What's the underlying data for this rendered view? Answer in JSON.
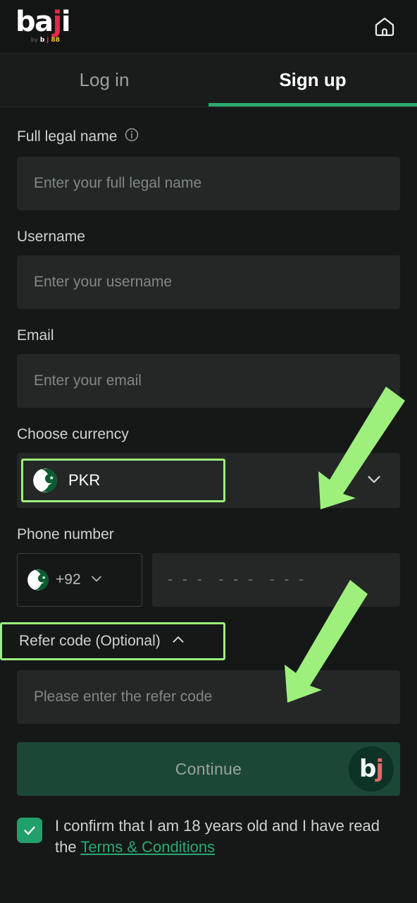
{
  "brand": {
    "logo_main_1": "ba",
    "logo_main_j": "j",
    "logo_main_2": "i",
    "logo_sub_by": "by",
    "logo_sub_b": "b",
    "logo_sub_j": "j",
    "logo_sub_88": "88",
    "badge_b": "b",
    "badge_j": "j",
    "accent_green": "#2aa971",
    "accent_red": "#e8254a",
    "accent_yellow": "#f5c518",
    "highlight_green": "#9ef07c",
    "button_green": "#1c4736",
    "checkbox_green": "#22a06b"
  },
  "header": {
    "home_icon": "home-icon"
  },
  "tabs": [
    {
      "label": "Log in",
      "active": false
    },
    {
      "label": "Sign up",
      "active": true
    }
  ],
  "form": {
    "full_name": {
      "label": "Full legal name",
      "info_icon": "info-circle-icon",
      "placeholder": "Enter your full legal name",
      "value": ""
    },
    "username": {
      "label": "Username",
      "placeholder": "Enter your username",
      "value": ""
    },
    "email": {
      "label": "Email",
      "placeholder": "Enter your email",
      "value": ""
    },
    "currency": {
      "label": "Choose currency",
      "selected_code": "PKR",
      "flag": "pakistan-flag-icon",
      "chevron": "chevron-down-icon"
    },
    "phone": {
      "label": "Phone number",
      "country_code": "+92",
      "flag": "pakistan-flag-icon",
      "chevron": "chevron-down-icon",
      "placeholder": "- - -  - - -  - - -",
      "value": ""
    },
    "refer": {
      "toggle_label": "Refer code (Optional)",
      "chevron": "chevron-up-icon",
      "placeholder": "Please enter the refer code",
      "value": ""
    }
  },
  "actions": {
    "continue_label": "Continue"
  },
  "consent": {
    "text_before": "I confirm that I am 18 years old and I have read the ",
    "link_text": "Terms & Conditions",
    "checked": true
  },
  "annotations": {
    "arrow_1": "green-arrow-pointing-to-currency-selector",
    "arrow_2": "green-arrow-pointing-to-refer-code-input",
    "box_1": "highlight-box-currency",
    "box_2": "highlight-box-refer-code"
  }
}
